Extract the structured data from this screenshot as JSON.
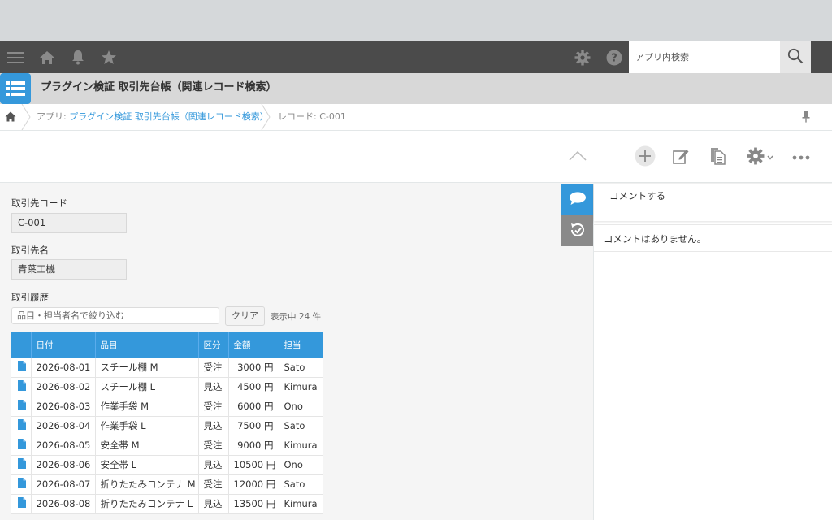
{
  "topbar": {
    "search_placeholder": "アプリ内検索",
    "icons": [
      "menu-icon",
      "home-icon",
      "bell-icon",
      "star-icon",
      "gear-icon",
      "help-icon",
      "search-icon"
    ]
  },
  "app": {
    "title": "プラグイン検証 取引先台帳（関連レコード検索）"
  },
  "breadcrumb": {
    "app_prefix": "アプリ: ",
    "app_link": "プラグイン検証 取引先台帳（関連レコード検索）",
    "record": "レコード: C-001"
  },
  "record": {
    "code_label": "取引先コード",
    "code_value": "C-001",
    "name_label": "取引先名",
    "name_value": "青葉工機",
    "history_label": "取引履歴"
  },
  "filter": {
    "placeholder": "品目・担当者名で絞り込む",
    "clear_label": "クリア",
    "count_text": "表示中 24 件"
  },
  "table": {
    "headers": [
      "",
      "日付",
      "品目",
      "区分",
      "金額",
      "担当"
    ],
    "rows": [
      {
        "date": "2026-08-01",
        "item": "スチール棚 M",
        "type": "受注",
        "amount": "3000 円",
        "owner": "Sato"
      },
      {
        "date": "2026-08-02",
        "item": "スチール棚 L",
        "type": "見込",
        "amount": "4500 円",
        "owner": "Kimura"
      },
      {
        "date": "2026-08-03",
        "item": "作業手袋 M",
        "type": "受注",
        "amount": "6000 円",
        "owner": "Ono"
      },
      {
        "date": "2026-08-04",
        "item": "作業手袋 L",
        "type": "見込",
        "amount": "7500 円",
        "owner": "Sato"
      },
      {
        "date": "2026-08-05",
        "item": "安全帯 M",
        "type": "受注",
        "amount": "9000 円",
        "owner": "Kimura"
      },
      {
        "date": "2026-08-06",
        "item": "安全帯 L",
        "type": "見込",
        "amount": "10500 円",
        "owner": "Ono"
      },
      {
        "date": "2026-08-07",
        "item": "折りたたみコンテナ M",
        "type": "受注",
        "amount": "12000 円",
        "owner": "Sato"
      },
      {
        "date": "2026-08-08",
        "item": "折りたたみコンテナ L",
        "type": "見込",
        "amount": "13500 円",
        "owner": "Kimura"
      }
    ]
  },
  "side": {
    "comment_prompt": "コメントする",
    "no_comments": "コメントはありません。"
  },
  "colors": {
    "accent": "#3498db",
    "topbar": "#4b4b4b"
  }
}
